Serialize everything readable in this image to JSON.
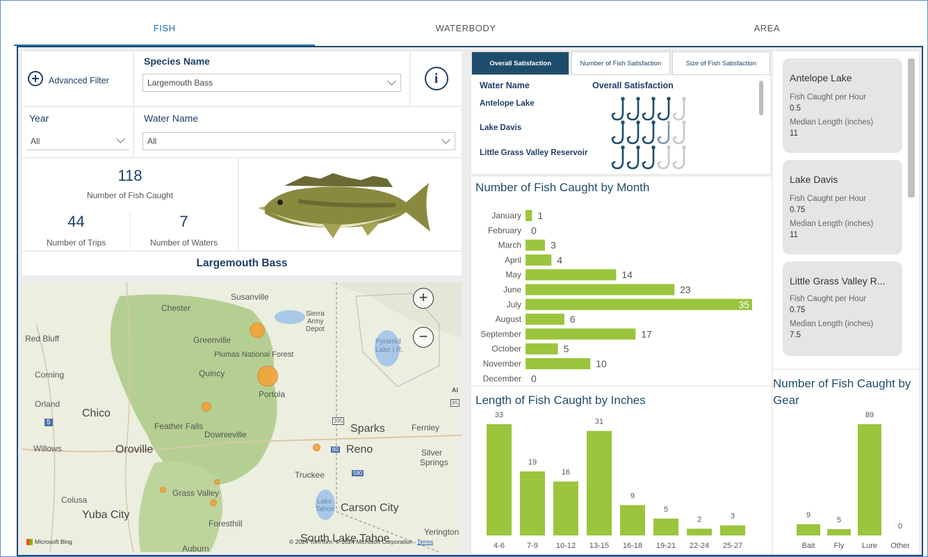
{
  "tabs": [
    {
      "label": "FISH",
      "active": true
    },
    {
      "label": "WATERBODY",
      "active": false
    },
    {
      "label": "AREA",
      "active": false
    }
  ],
  "filters": {
    "advanced_filter_label": "Advanced Filter",
    "species_title": "Species Name",
    "species_value": "Largemouth Bass",
    "year_title": "Year",
    "year_value": "All",
    "water_title": "Water Name",
    "water_value": "All",
    "info_glyph": "i"
  },
  "kpis": {
    "fish_caught_value": "118",
    "fish_caught_label": "Number of Fish Caught",
    "trips_value": "44",
    "trips_label": "Number of Trips",
    "waters_value": "7",
    "waters_label": "Number of Waters"
  },
  "species_heading": "Largemouth Bass",
  "map": {
    "labels": {
      "susanville": "Susanville",
      "chester": "Chester",
      "sierra_army": "Sierra",
      "sierra_army2": "Army",
      "sierra_army3": "Depot",
      "red_bluff": "Red Bluff",
      "greenville": "Greenville",
      "pyramid": "Pyramid",
      "pyramid2": "Lake I.R.",
      "plumas": "Plumas National Forest",
      "corning": "Corning",
      "quincy": "Quincy",
      "portola": "Portola",
      "orland": "Orland",
      "chico": "Chico",
      "feather_falls": "Feather Falls",
      "downieville": "Downieville",
      "sparks": "Sparks",
      "fernley": "Fernley",
      "willows": "Willows",
      "oroville": "Oroville",
      "reno": "Reno",
      "silver": "Silver",
      "springs": "Springs",
      "truckee": "Truckee",
      "grass_valley": "Grass Valley",
      "colusa": "Colusa",
      "yuba_city": "Yuba City",
      "lake_tahoe": "Lake",
      "lake_tahoe2": "Tahoe",
      "carson_city": "Carson City",
      "foresthill": "Foresthill",
      "south_lake_tahoe": "South Lake Tahoe",
      "yerington": "Yerington",
      "auburn": "Auburn",
      "hwy_5": "5",
      "hwy_395": "395",
      "hwy_80": "80",
      "hwy_580": "580",
      "hwy_95": "95",
      "al": "Al"
    },
    "bing": "Microsoft Bing",
    "copyright": "© 2024 TomTom, © 2024 Microsoft Corporation",
    "terms": "Terms",
    "zoom_in": "+",
    "zoom_out": "−"
  },
  "satisfaction": {
    "tabs": [
      {
        "label": "Overall Satisfaction",
        "active": true
      },
      {
        "label": "Number of Fish Satisfaction",
        "active": false
      },
      {
        "label": "Size of Fish Satisfaction",
        "active": false
      }
    ],
    "col_water": "Water Name",
    "col_rating": "Overall Satisfaction",
    "rows": [
      {
        "name": "Antelope Lake",
        "rating": 4,
        "max": 5
      },
      {
        "name": "Lake Davis",
        "rating": 3.5,
        "max": 5
      },
      {
        "name": "Little Grass Valley Reservoir",
        "rating": 3,
        "max": 5
      }
    ]
  },
  "cards": [
    {
      "title": "Antelope Lake",
      "rate_label": "Fish Caught per Hour",
      "rate": "0.5",
      "len_label": "Median Length (inches)",
      "len": "11"
    },
    {
      "title": "Lake Davis",
      "rate_label": "Fish Caught per Hour",
      "rate": "0.75",
      "len_label": "Median Length (inches)",
      "len": "11"
    },
    {
      "title": "Little Grass Valley R...",
      "rate_label": "Fish Caught per Hour",
      "rate": "0.75",
      "len_label": "Median Length (inches)",
      "len": "7.5"
    }
  ],
  "colors": {
    "bar": "#9bc53d",
    "accent": "#1e4d6b",
    "hook_full": "#1e4d6b",
    "hook_empty": "#c8c8c8",
    "dot": "#f2a23a"
  },
  "chart_data": [
    {
      "type": "bar",
      "orientation": "horizontal",
      "title": "Number of Fish Caught by Month",
      "categories": [
        "January",
        "February",
        "March",
        "April",
        "May",
        "June",
        "July",
        "August",
        "September",
        "October",
        "November",
        "December"
      ],
      "values": [
        1,
        0,
        3,
        4,
        14,
        23,
        35,
        6,
        17,
        5,
        10,
        0
      ]
    },
    {
      "type": "bar",
      "title": "Length of Fish Caught by Inches",
      "categories": [
        "4-6",
        "7-9",
        "10-12",
        "13-15",
        "16-18",
        "19-21",
        "22-24",
        "25-27"
      ],
      "values": [
        33,
        19,
        16,
        31,
        9,
        5,
        2,
        3
      ]
    },
    {
      "type": "bar",
      "title": "Number of Fish Caught by Gear",
      "categories": [
        "Bait",
        "Fly",
        "Lure",
        "Other"
      ],
      "values": [
        9,
        5,
        89,
        0
      ]
    }
  ]
}
